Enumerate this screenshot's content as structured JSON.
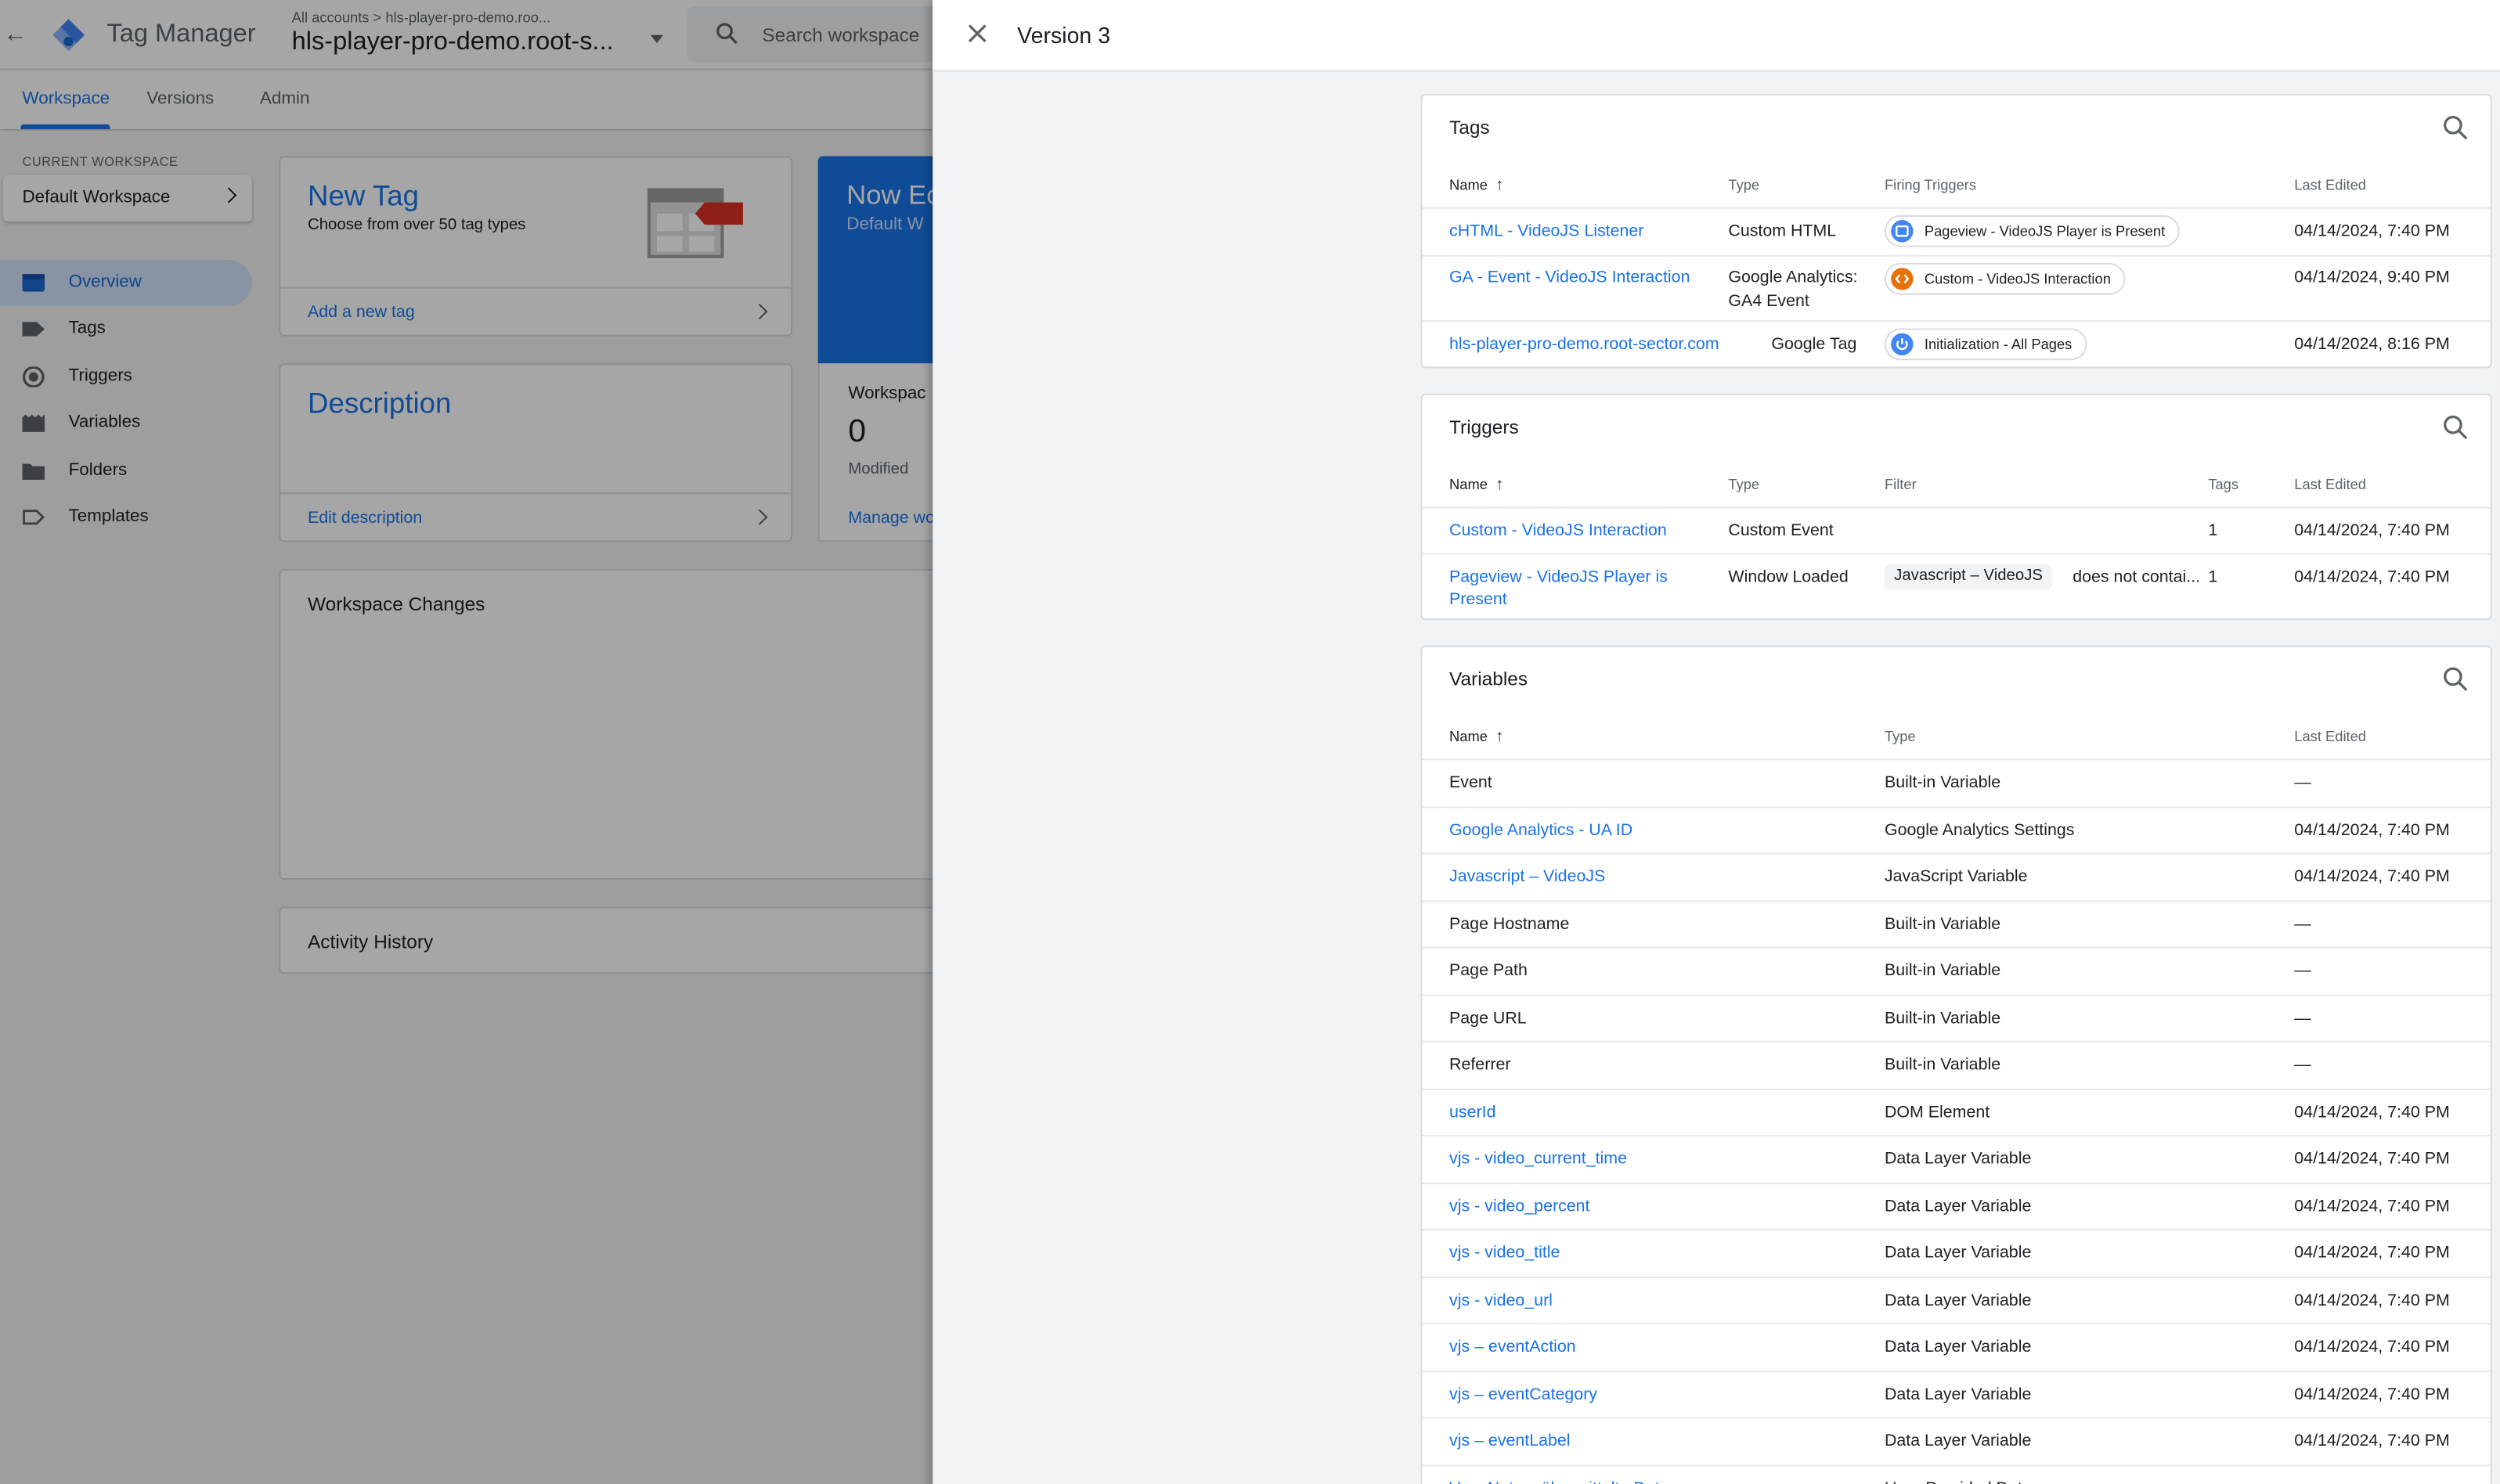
{
  "app": {
    "title": "Tag Manager",
    "breadcrumb": "All accounts > hls-player-pro-demo.roo...",
    "container": "hls-player-pro-demo.root-s...",
    "search_placeholder": "Search workspace"
  },
  "nav": {
    "tabs": [
      {
        "label": "Workspace"
      },
      {
        "label": "Versions"
      },
      {
        "label": "Admin"
      }
    ]
  },
  "sidebar": {
    "current_workspace_label": "CURRENT WORKSPACE",
    "workspace": "Default Workspace",
    "items": [
      {
        "label": "Overview",
        "icon": "overview-icon"
      },
      {
        "label": "Tags",
        "icon": "tag-icon"
      },
      {
        "label": "Triggers",
        "icon": "trigger-icon"
      },
      {
        "label": "Variables",
        "icon": "variables-icon"
      },
      {
        "label": "Folders",
        "icon": "folder-icon"
      },
      {
        "label": "Templates",
        "icon": "template-icon"
      }
    ]
  },
  "cards": {
    "new_tag": {
      "title": "New Tag",
      "subtitle": "Choose from over 50 tag types",
      "action": "Add a new tag"
    },
    "description": {
      "title": "Description",
      "action": "Edit description"
    },
    "now_editing": {
      "title": "Now Ec",
      "subtitle": "Default W"
    },
    "workspace_stats": {
      "label": "Workspac",
      "count": "0",
      "count_label": "Modified",
      "action": "Manage wo"
    },
    "workspace_changes": {
      "title": "Workspace Changes"
    },
    "activity_history": {
      "title": "Activity History"
    }
  },
  "drawer": {
    "title": "Version 3",
    "tags": {
      "title": "Tags",
      "headers": [
        "Name",
        "Type",
        "Firing Triggers",
        "Last Edited"
      ],
      "rows": [
        {
          "name": "cHTML - VideoJS Listener",
          "type": "Custom HTML",
          "type2": "",
          "trigger": "Pageview - VideoJS Player is Present",
          "last_edited": "04/14/2024, 7:40 PM"
        },
        {
          "name": "GA - Event - VideoJS Interaction",
          "type": "Google Analytics:",
          "type2": "GA4 Event",
          "trigger": "Custom - VideoJS Interaction",
          "last_edited": "04/14/2024, 9:40 PM"
        },
        {
          "name": "hls-player-pro-demo.root-sector.com",
          "type": "Google Tag",
          "type2": "",
          "trigger": "Initialization - All Pages",
          "last_edited": "04/14/2024, 8:16 PM"
        }
      ]
    },
    "triggers": {
      "title": "Triggers",
      "headers": [
        "Name",
        "Type",
        "Filter",
        "Tags",
        "Last Edited"
      ],
      "rows": [
        {
          "name": "Custom - VideoJS Interaction",
          "name2": "",
          "type": "Custom Event",
          "filter_var": "",
          "filter_op": "",
          "tags": "1",
          "last_edited": "04/14/2024, 7:40 PM"
        },
        {
          "name": "Pageview - VideoJS Player is",
          "name2": "Present",
          "type": "Window Loaded",
          "filter_var": "Javascript – VideoJS",
          "filter_op": "does not contai...",
          "tags": "1",
          "last_edited": "04/14/2024, 7:40 PM"
        }
      ]
    },
    "variables": {
      "title": "Variables",
      "headers": [
        "Name",
        "Type",
        "Last Edited"
      ],
      "rows": [
        {
          "name": "Event",
          "type": "Built-in Variable",
          "last_edited": "—",
          "link": false
        },
        {
          "name": "Google Analytics - UA ID",
          "type": "Google Analytics Settings",
          "last_edited": "04/14/2024, 7:40 PM",
          "link": true
        },
        {
          "name": "Javascript – VideoJS",
          "type": "JavaScript Variable",
          "last_edited": "04/14/2024, 7:40 PM",
          "link": true
        },
        {
          "name": "Page Hostname",
          "type": "Built-in Variable",
          "last_edited": "—",
          "link": false
        },
        {
          "name": "Page Path",
          "type": "Built-in Variable",
          "last_edited": "—",
          "link": false
        },
        {
          "name": "Page URL",
          "type": "Built-in Variable",
          "last_edited": "—",
          "link": false
        },
        {
          "name": "Referrer",
          "type": "Built-in Variable",
          "last_edited": "—",
          "link": false
        },
        {
          "name": "userId",
          "type": "DOM Element",
          "last_edited": "04/14/2024, 7:40 PM",
          "link": true
        },
        {
          "name": "vjs - video_current_time",
          "type": "Data Layer Variable",
          "last_edited": "04/14/2024, 7:40 PM",
          "link": true
        },
        {
          "name": "vjs - video_percent",
          "type": "Data Layer Variable",
          "last_edited": "04/14/2024, 7:40 PM",
          "link": true
        },
        {
          "name": "vjs - video_title",
          "type": "Data Layer Variable",
          "last_edited": "04/14/2024, 7:40 PM",
          "link": true
        },
        {
          "name": "vjs - video_url",
          "type": "Data Layer Variable",
          "last_edited": "04/14/2024, 7:40 PM",
          "link": true
        },
        {
          "name": "vjs – eventAction",
          "type": "Data Layer Variable",
          "last_edited": "04/14/2024, 7:40 PM",
          "link": true
        },
        {
          "name": "vjs – eventCategory",
          "type": "Data Layer Variable",
          "last_edited": "04/14/2024, 7:40 PM",
          "link": true
        },
        {
          "name": "vjs – eventLabel",
          "type": "Data Layer Variable",
          "last_edited": "04/14/2024, 7:40 PM",
          "link": true
        },
        {
          "name": "Vom Nutzer übermittelte Daten",
          "type": "User-Provided Data",
          "last_edited": "",
          "link": true
        }
      ]
    }
  },
  "colors": {
    "accent": "#1a73e8",
    "selected_bg": "#d2e3fc",
    "custom_chip": "#e8710a",
    "drawer_bg": "#f1f3f4"
  }
}
